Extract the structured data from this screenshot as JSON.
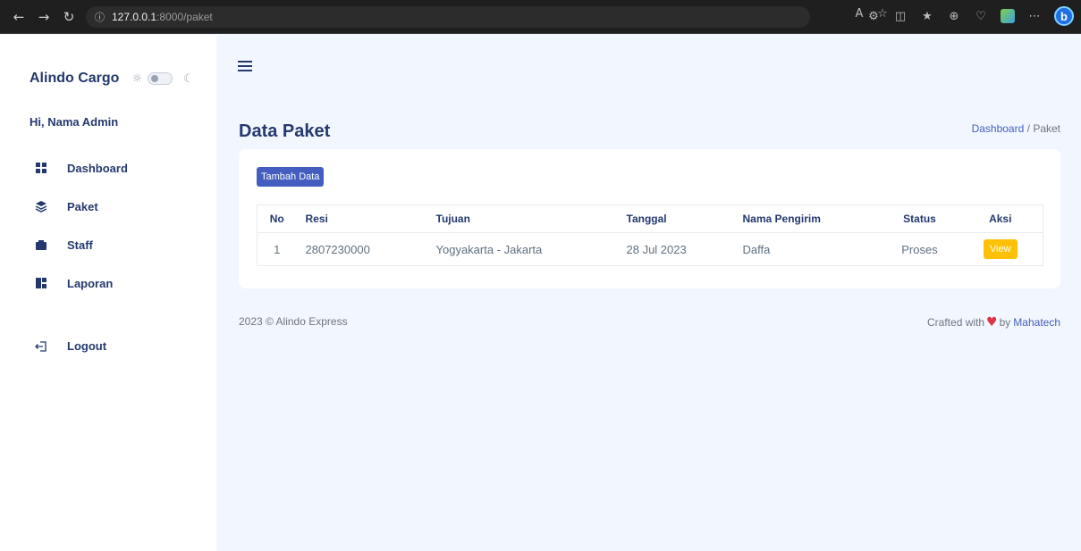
{
  "browser": {
    "url_host": "127.0.0.1",
    "url_path": ":8000/paket"
  },
  "sidebar": {
    "brand": "Alindo Cargo",
    "greeting": "Hi, Nama Admin",
    "items": [
      {
        "label": "Dashboard",
        "icon": "grid-icon"
      },
      {
        "label": "Paket",
        "icon": "stack-icon"
      },
      {
        "label": "Staff",
        "icon": "briefcase-icon"
      },
      {
        "label": "Laporan",
        "icon": "layout-icon"
      }
    ],
    "logout": "Logout"
  },
  "header": {
    "title": "Data Paket",
    "breadcrumb_home": "Dashboard",
    "breadcrumb_sep": "/",
    "breadcrumb_current": "Paket"
  },
  "actions": {
    "add_label": "Tambah Data"
  },
  "table": {
    "columns": [
      "No",
      "Resi",
      "Tujuan",
      "Tanggal",
      "Nama Pengirim",
      "Status",
      "Aksi"
    ],
    "rows": [
      {
        "no": "1",
        "resi": "2807230000",
        "tujuan": "Yogyakarta - Jakarta",
        "tanggal": "28 Jul 2023",
        "pengirim": "Daffa",
        "status": "Proses",
        "action": "View"
      }
    ]
  },
  "footer": {
    "copyright": "2023 © Alindo Express",
    "crafted_prefix": "Crafted with",
    "crafted_by": "by",
    "author": "Mahatech"
  },
  "colors": {
    "primary": "#435ebe",
    "warning": "#ffc107",
    "background": "#f2f7ff",
    "text": "#25396f"
  }
}
